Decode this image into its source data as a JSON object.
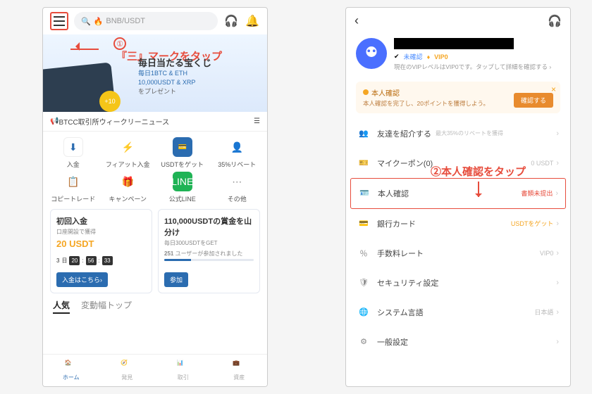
{
  "left": {
    "search_text": "BNB/USDT",
    "annotation": {
      "num": "①",
      "text": "『三』マークをタップ"
    },
    "hero": {
      "title": "毎日当たる宝くじ",
      "line1": "毎日1BTC & ETH",
      "line2": "10,000USDT & XRP",
      "line3": "をプレゼント",
      "badge": "+10"
    },
    "news": "BTCC取引所ウィークリーニュース",
    "quick": [
      {
        "label": "入金"
      },
      {
        "label": "フィアット入金"
      },
      {
        "label": "USDTをゲット"
      },
      {
        "label": "35%リベート"
      },
      {
        "label": "コピートレード"
      },
      {
        "label": "キャンペーン"
      },
      {
        "label": "公式LINE"
      },
      {
        "label": "その他"
      }
    ],
    "promo1": {
      "title": "初回入金",
      "sub": "口座開設で獲得",
      "amount": "20 USDT",
      "cd": {
        "d": "3",
        "h": "20",
        "m": "56",
        "s": "33",
        "sep1": "日"
      },
      "btn": "入金はこちら"
    },
    "promo2": {
      "title": "110,000USDTの賞金を山分け",
      "sub": "毎日300USDTをGET",
      "participants_n": "251",
      "participants_t": "ユーザーが参加されました",
      "btn": "参加"
    },
    "tabs": {
      "t1": "人気",
      "t2": "変動幅トップ"
    },
    "nav": {
      "n1": "ホーム",
      "n2": "発見",
      "n3": "取引",
      "n4": "資産"
    }
  },
  "right": {
    "unverified": "未確認",
    "vip": "VIP0",
    "vip_desc": "現在のVIPレベルはVIP0です。タップして詳細を確認する",
    "banner": {
      "title": "本人確認",
      "desc": "本人確認を完了し、20ポイントを獲得しよう。",
      "btn": "確認する"
    },
    "annotation": "②本人確認をタップ",
    "menu": [
      {
        "label": "友達を紹介する",
        "sub": "最大35%のリベートを獲得",
        "right": ""
      },
      {
        "label": "マイクーポン(0)",
        "right": "0 USDT"
      },
      {
        "label": "本人確認",
        "right": "書類未提出"
      },
      {
        "label": "銀行カード",
        "right": "USDTをゲット"
      },
      {
        "label": "手数料レート",
        "right": "VIP0"
      },
      {
        "label": "セキュリティ設定",
        "right": ""
      },
      {
        "label": "システム言語",
        "right": "日本語"
      },
      {
        "label": "一般設定",
        "right": ""
      }
    ]
  }
}
